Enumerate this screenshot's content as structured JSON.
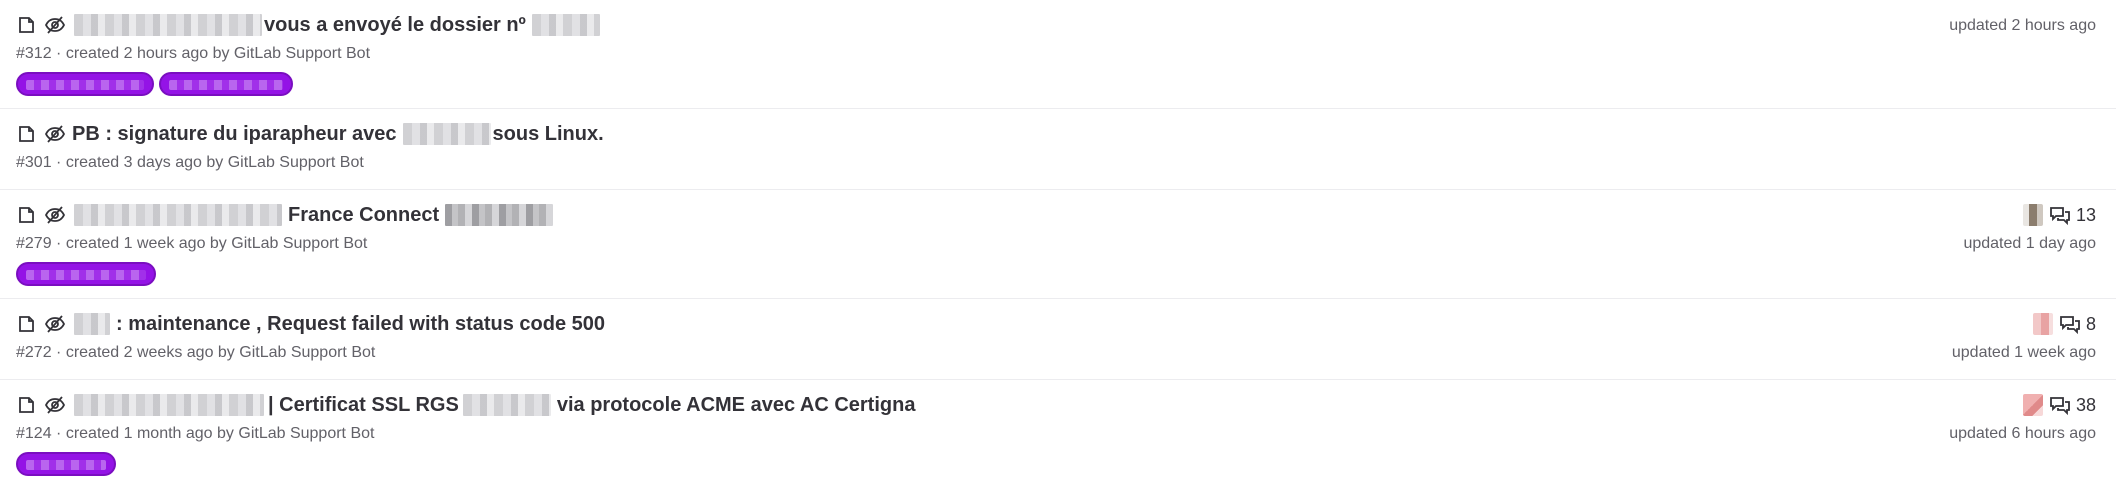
{
  "issues": [
    {
      "title_suffix": "vous a envoyé le dossier nº",
      "meta": "#312 · created 2 hours ago by GitLab Support Bot",
      "updated": "updated 2 hours ago",
      "comments": "",
      "labels": 2
    },
    {
      "title_prefix": "PB : signature du iparapheur avec",
      "title_suffix": "sous Linux.",
      "meta": "#301 · created 3 days ago by GitLab Support Bot",
      "updated": "",
      "comments": "",
      "labels": 0
    },
    {
      "title_middle": "France Connect",
      "meta": "#279 · created 1 week ago by GitLab Support Bot",
      "updated": "updated 1 day ago",
      "comments": "13",
      "labels": 1
    },
    {
      "title_suffix": ": maintenance , Request failed with status code 500",
      "meta": "#272 · created 2 weeks ago by GitLab Support Bot",
      "updated": "updated 1 week ago",
      "comments": "8",
      "labels": 0
    },
    {
      "title_middle": "| Certificat SSL RGS",
      "title_suffix": "via protocole ACME avec AC Certigna",
      "meta": "#124 · created 1 month ago by GitLab Support Bot",
      "updated": "updated 6 hours ago",
      "comments": "38",
      "labels": 1
    }
  ],
  "icons": {
    "issue_type": "issue-open-icon",
    "confidential": "eye-slash-icon",
    "comments": "comments-icon"
  },
  "colors": {
    "label": "#9413e6",
    "text": "#333238",
    "muted": "#626168",
    "divider": "#ececef"
  }
}
